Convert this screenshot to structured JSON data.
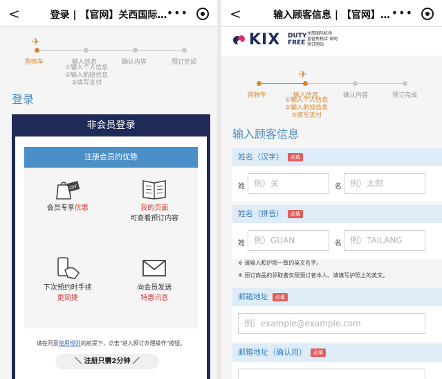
{
  "left": {
    "topbar": {
      "back": "<",
      "title": "登录 | 【官网】关西国际…",
      "more": "•••"
    },
    "steps": [
      {
        "label": "购物车",
        "active": true
      },
      {
        "label": "输入信息",
        "sub": [
          "①输入个人信息",
          "②输入航班信息",
          "③填写支付"
        ],
        "active": false
      },
      {
        "label": "确认内容",
        "active": false
      },
      {
        "label": "预订完成",
        "active": false
      }
    ],
    "section_title": "登录",
    "card": {
      "title": "非会员登录",
      "benefits_button": "注册会员的优势",
      "benefits": [
        {
          "line1_a": "会员专享",
          "line1_b": "优惠",
          "line2": "",
          "icon": "shopping-bag-icon"
        },
        {
          "line1_a": "",
          "line1_b": "我的页面",
          "line2": "可查看预订内容",
          "icon": "open-book-icon"
        },
        {
          "line1_a": "下次预约时手续",
          "line1_b": "",
          "line2": "更简捷",
          "icon": "phone-tap-icon"
        },
        {
          "line1_a": "向会员发送",
          "line1_b": "",
          "line2": "特惠讯息",
          "icon": "envelope-icon"
        }
      ],
      "consent_pre": "请在同意",
      "consent_link": "使用规则",
      "consent_post": "的前提下，点击\"进入预订办理操作\"按钮。",
      "quick": "＼ 注册只需2分钟 ／"
    }
  },
  "right": {
    "topbar": {
      "back": "<",
      "title": "输入顾客信息 | 【官网】…",
      "more": "•••"
    },
    "logo": {
      "kix": "KIX",
      "duty": "DUTY",
      "free": "FREE",
      "sub": [
        "关西国际机场",
        "直营免税店 官网",
        "预订网站"
      ]
    },
    "steps": [
      {
        "label": "购物车",
        "active": true
      },
      {
        "label": "输入信息",
        "sub": [
          "①输入个人信息",
          "②输入航班信息",
          "③填写支付"
        ],
        "active": true
      },
      {
        "label": "确认内容",
        "active": false
      },
      {
        "label": "预订完成",
        "active": false
      }
    ],
    "section_title": "输入顾客信息",
    "required": "必填",
    "fields": {
      "name_kanji": {
        "label": "姓名（汉字）",
        "surname_label": "姓",
        "given_label": "名",
        "surname_ph": "例）关",
        "given_ph": "例）太郎"
      },
      "name_pinyin": {
        "label": "姓名（拼音）",
        "surname_label": "姓",
        "given_label": "名",
        "surname_ph": "例）GUAN",
        "given_ph": "例）TAILANG"
      },
      "notes": [
        "※ 请输入和护照一致的英文名字。",
        "※ 预订商品的领取者仅限预订者本人。请填写护照上的英文。"
      ],
      "email": {
        "label": "邮箱地址",
        "ph": "例）example@example.com"
      },
      "email_confirm": {
        "label": "邮箱地址（确认用）"
      }
    }
  },
  "colors": {
    "accent": "#d9852d",
    "navy": "#1f2a56",
    "blue": "#4b8fc8",
    "required": "#e25c5c"
  }
}
